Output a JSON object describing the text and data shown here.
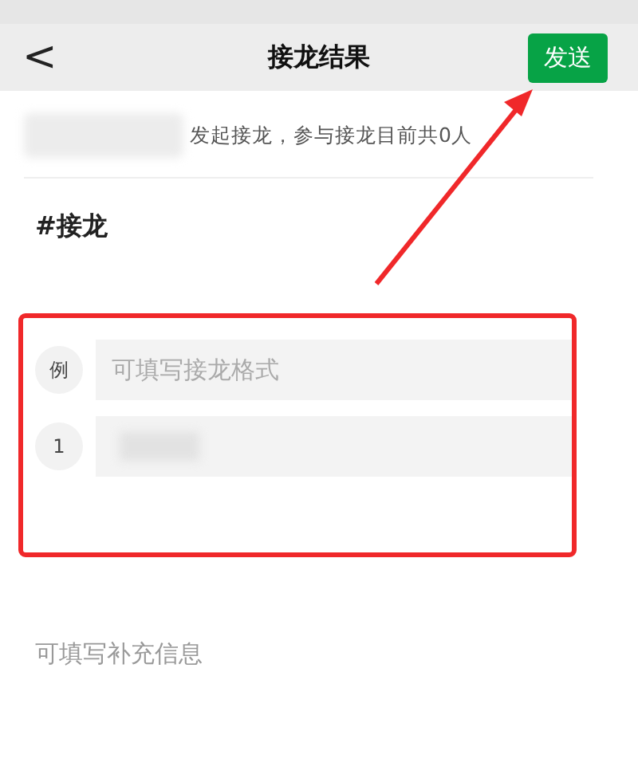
{
  "nav_bar": {
    "back": "<",
    "title": "接龙结果",
    "send_button": "发送"
  },
  "summary": {
    "text": "发起接龙，参与接龙目前共0人"
  },
  "topic": "#接龙",
  "entries": [
    {
      "marker": "例",
      "placeholder": "可填写接龙格式",
      "kind": "example"
    },
    {
      "marker": "1",
      "kind": "blurred"
    }
  ],
  "note": {
    "placeholder": "可填写补充信息"
  }
}
